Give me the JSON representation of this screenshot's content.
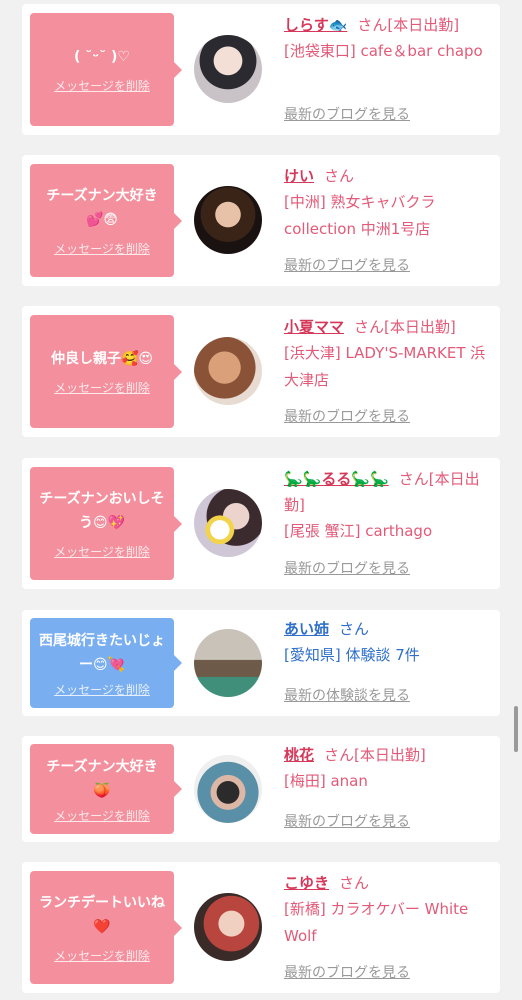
{
  "entries": [
    {
      "message": "( ˘ᵕ˘ )♡",
      "delete_label": "メッセージを削除",
      "name": "しらす🐟",
      "suffix": "さん[本日出勤]",
      "shop": "[池袋東口] cafe＆bar chapo",
      "link": "最新のブログを見る",
      "theme": "pink"
    },
    {
      "message": "チーズナン大好き💕😨",
      "delete_label": "メッセージを削除",
      "name": "けい",
      "suffix": "さん",
      "shop": "[中洲] 熟女キャバクラ collection 中洲1号店",
      "link": "最新のブログを見る",
      "theme": "pink"
    },
    {
      "message": "仲良し親子🥰😍",
      "delete_label": "メッセージを削除",
      "name": "小夏ママ",
      "suffix": "さん[本日出勤]",
      "shop": "[浜大津] LADY'S-MARKET 浜大津店",
      "link": "最新のブログを見る",
      "theme": "pink"
    },
    {
      "message": "チーズナンおいしそう😊💖",
      "delete_label": "メッセージを削除",
      "name": "🦕🦕るる🦕🦕",
      "suffix": "さん[本日出勤]",
      "shop": "[尾張 蟹江] carthago",
      "link": "最新のブログを見る",
      "theme": "pink"
    },
    {
      "message": "西尾城行きたいじょー😊💘",
      "delete_label": "メッセージを削除",
      "name": "あい姉",
      "suffix": "さん",
      "shop": "[愛知県] 体験談 7件",
      "link": "最新の体験談を見る",
      "theme": "blue"
    },
    {
      "message": "チーズナン大好き🍑",
      "delete_label": "メッセージを削除",
      "name": "桃花",
      "suffix": "さん[本日出勤]",
      "shop": "[梅田] anan",
      "link": "最新のブログを見る",
      "theme": "pink"
    },
    {
      "message": "ランチデートいいね❤️",
      "delete_label": "メッセージを削除",
      "name": "こゆき",
      "suffix": "さん",
      "shop": "[新橋] カラオケバー White Wolf",
      "link": "最新のブログを見る",
      "theme": "pink"
    }
  ]
}
